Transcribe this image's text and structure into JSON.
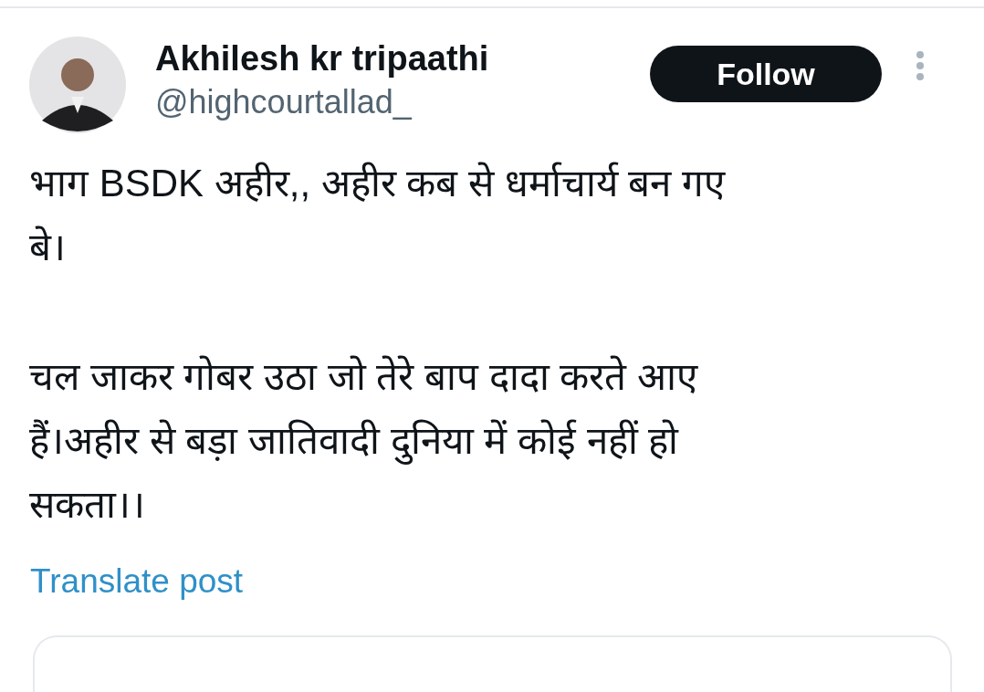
{
  "post": {
    "author": {
      "name": "Akhilesh kr tripaathi",
      "handle": "@highcourtallad_"
    },
    "follow_button": "Follow",
    "paragraphs": [
      {
        "lines": [
          "भाग BSDK अहीर,, अहीर कब से धर्माचार्य बन गए",
          "बे।"
        ]
      },
      {
        "lines": [
          "चल जाकर गोबर उठा जो तेरे बाप दादा करते आए",
          "हैं।अहीर से बड़ा जातिवादी दुनिया में कोई नहीं हो",
          "सकता।।"
        ]
      }
    ],
    "translate_link": "Translate post"
  }
}
